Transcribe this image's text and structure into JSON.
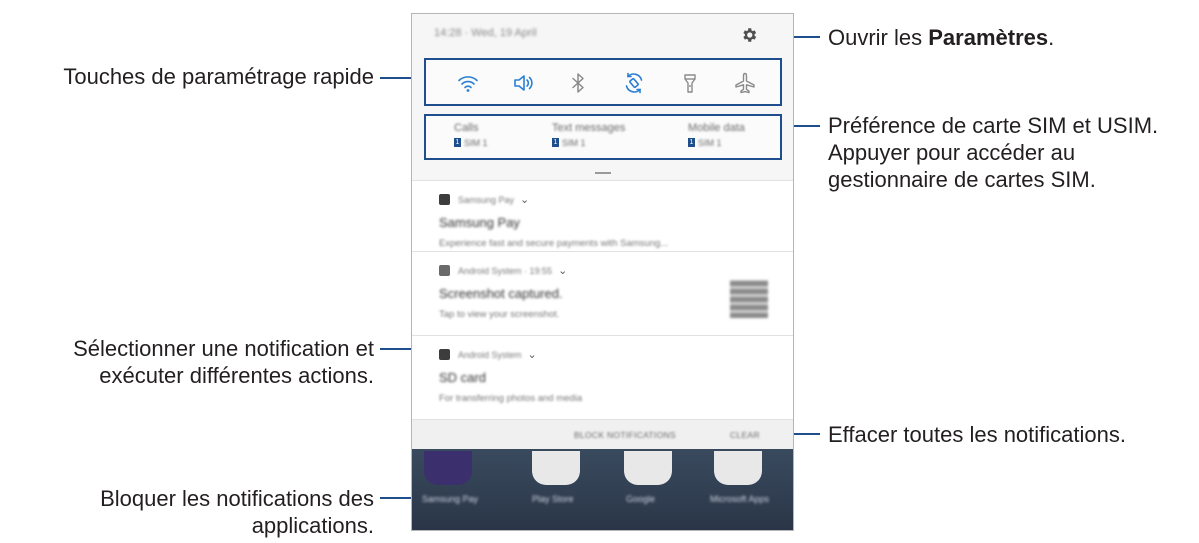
{
  "callouts": {
    "settings_prefix": "Ouvrir les ",
    "settings_bold": "Paramètres",
    "settings_suffix": ".",
    "quick_settings": "Touches de paramétrage rapide",
    "sim_line1": "Préférence de carte SIM et USIM.",
    "sim_line2": "Appuyer pour accéder au",
    "sim_line3": "gestionnaire de cartes SIM.",
    "select_line1": "Sélectionner une notification et",
    "select_line2": "exécuter différentes actions.",
    "clear": "Effacer toutes les notifications.",
    "block_line1": "Bloquer les notifications des",
    "block_line2": "applications."
  },
  "status": {
    "time_date": "14:28  ·  Wed, 19 April"
  },
  "quick_settings": [
    "wifi-icon",
    "sound-icon",
    "bluetooth-icon",
    "auto-rotate-icon",
    "flashlight-icon",
    "airplane-mode-icon"
  ],
  "sim": [
    {
      "title": "Calls",
      "sim": "SIM 1"
    },
    {
      "title": "Text messages",
      "sim": "SIM 1"
    },
    {
      "title": "Mobile data",
      "sim": "SIM 1"
    }
  ],
  "notifications": [
    {
      "app": "Samsung Pay",
      "title": "Samsung Pay",
      "body": "Experience fast and secure payments with Samsung..."
    },
    {
      "app": "Android System · 19:55",
      "title": "Screenshot captured.",
      "body": "Tap to view your screenshot."
    },
    {
      "app": "Android System",
      "title": "SD card",
      "body": "For transferring photos and media"
    }
  ],
  "actions": {
    "block": "BLOCK NOTIFICATIONS",
    "clear": "CLEAR"
  },
  "home_apps": [
    "Samsung Pay",
    "Play Store",
    "Google",
    "Microsoft Apps"
  ],
  "colors": {
    "accent": "#1f4e8c",
    "qs_icon": "#2a7fd4"
  }
}
